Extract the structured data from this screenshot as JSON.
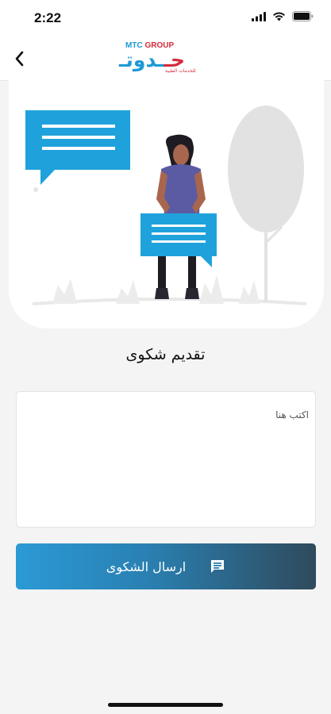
{
  "status_bar": {
    "time": "2:22"
  },
  "header": {
    "logo": {
      "brand_prefix": "MTC",
      "brand_suffix": "GROUP",
      "arabic_part1": "حـ",
      "arabic_part2": "ـدوتـ",
      "tagline": "للخدمات الطبية"
    }
  },
  "page": {
    "title": "تقديم شكوى"
  },
  "complaint_form": {
    "placeholder": "اكتب هنا",
    "value": "",
    "submit_label": "ارسال الشكوى"
  },
  "colors": {
    "accent": "#2b9ad6",
    "button_gradient_end": "#2f4a5c",
    "illustration_bubble": "#1fa2dc",
    "illustration_shirt": "#5b5ba3"
  },
  "icons": {
    "back": "chevron-left-icon",
    "submit": "message-icon"
  }
}
